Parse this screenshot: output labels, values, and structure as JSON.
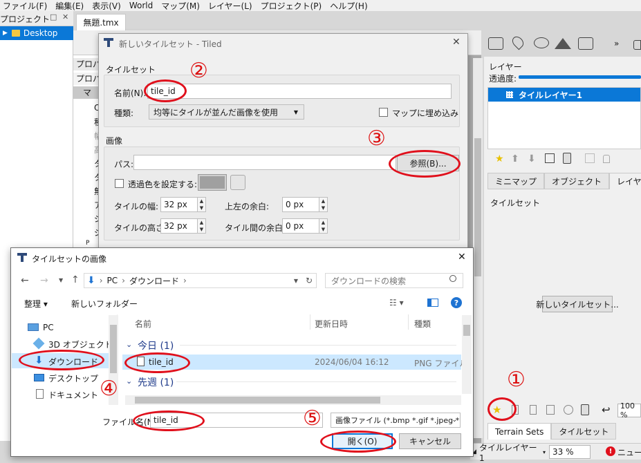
{
  "menu": [
    "ファイル(F)",
    "編集(E)",
    "表示(V)",
    "World",
    "マップ(M)",
    "レイヤー(L)",
    "プロジェクト(P)",
    "ヘルプ(H)"
  ],
  "project_panel": {
    "title": "プロジェクト",
    "float_icon": "□",
    "close_icon": "✕",
    "item": "Desktop"
  },
  "doc_tab": "無題.tmx",
  "props": {
    "head1": "プロパ",
    "head2": "プロパ",
    "rows": [
      "マ",
      "O",
      "種",
      "幅",
      "高",
      "タ",
      "タ",
      "無",
      "ア",
      "ジ",
      "ジ",
      "P"
    ]
  },
  "layers_panel": {
    "title": "レイヤー",
    "opacity_label": "透過度:",
    "layer_name": "タイルレイヤー1",
    "tabs": [
      "ミニマップ",
      "オブジェクト",
      "レイヤー"
    ],
    "tileset_label": "タイルセット",
    "new_tileset_button": "新しいタイルセット...",
    "bottom_tabs": [
      "Terrain Sets",
      "タイルセット"
    ],
    "zoom": "100 %"
  },
  "statusbar": {
    "layer": "タイルレイヤー1",
    "zoom": "33 %",
    "news": "ニュース"
  },
  "tiled_dialog": {
    "title": "新しいタイルセット - Tiled",
    "tileset_group": "タイルセット",
    "name_label": "名前(N):",
    "name_value": "tile_id",
    "type_label": "種類:",
    "type_value": "均等にタイルが並んだ画像を使用",
    "embed_label": "マップに埋め込み",
    "image_group": "画像",
    "path_label": "パス:",
    "browse_button": "参照(B)...",
    "transparent_label": "透過色を設定する:",
    "tile_width_label": "タイルの幅:",
    "tile_width_value": "32 px",
    "tile_height_label": "タイルの高さ:",
    "tile_height_value": "32 px",
    "margin_label": "上左の余白:",
    "margin_value": "0 px",
    "spacing_label": "タイル間の余白:",
    "spacing_value": "0 px"
  },
  "file_dialog": {
    "title": "タイルセットの画像",
    "breadcrumb": [
      "PC",
      "ダウンロード"
    ],
    "search_placeholder": "ダウンロードの検索",
    "organize": "整理 ▾",
    "new_folder": "新しいフォルダー",
    "nav": [
      "PC",
      "3D オブジェクト",
      "ダウンロード",
      "デスクトップ",
      "ドキュメント"
    ],
    "columns": [
      "名前",
      "更新日時",
      "種類"
    ],
    "group_today": "今日 (1)",
    "group_lastweek": "先週 (1)",
    "file": {
      "name": "tile_id",
      "date": "2024/06/04 16:12",
      "type": "PNG ファイル"
    },
    "filename_label": "ファイル名(N):",
    "filename_value": "tile_id",
    "filter": "画像ファイル (*.bmp *.gif *.jpeg *",
    "open_button": "開く(O)",
    "cancel_button": "キャンセル"
  },
  "annotations": [
    "①",
    "②",
    "③",
    "④",
    "⑤"
  ],
  "colors": {
    "accent": "#0b78d7",
    "annotation": "#e0101c"
  }
}
